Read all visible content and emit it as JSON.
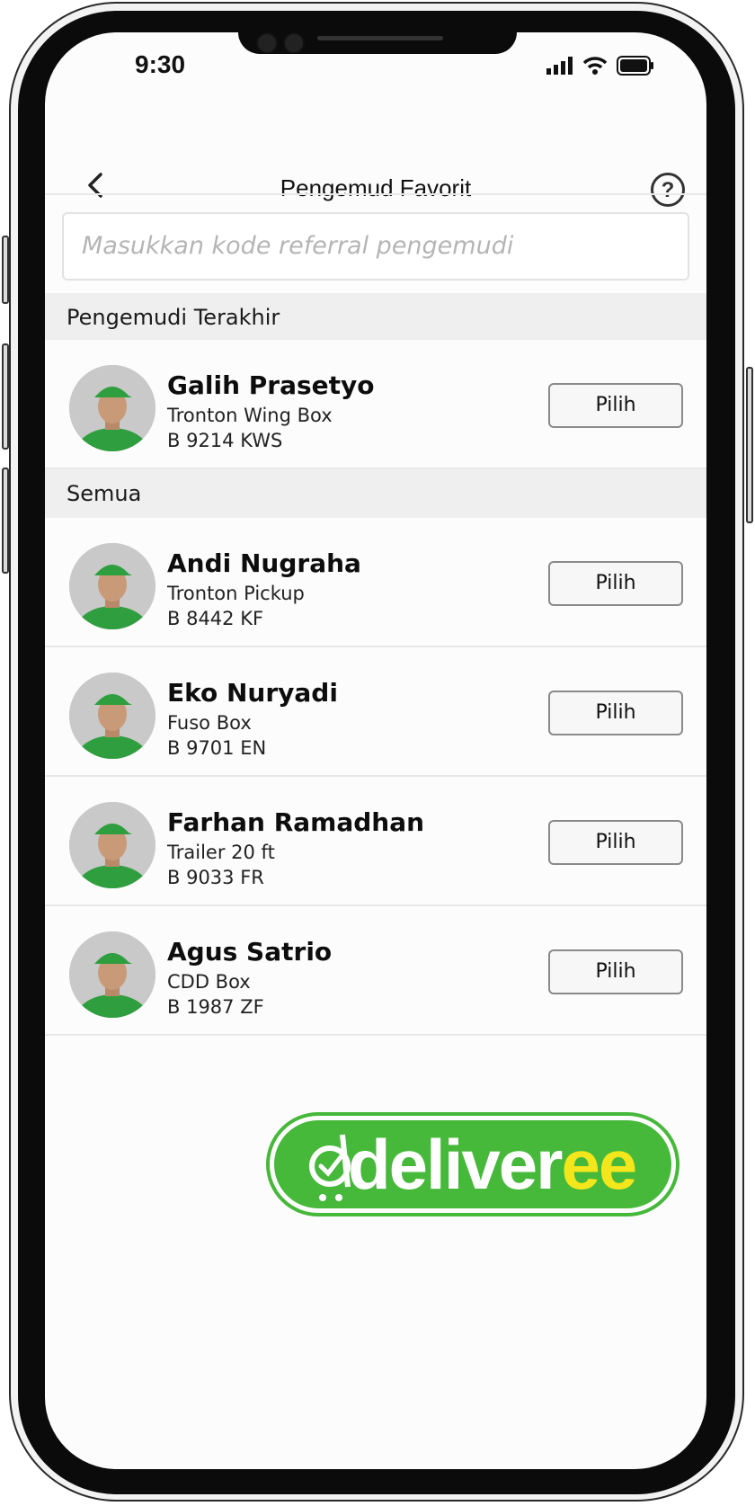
{
  "status_bar": {
    "time": "9:30"
  },
  "header": {
    "title": "Pengemud Favorit",
    "help_label": "?"
  },
  "search": {
    "placeholder": "Masukkan kode referral pengemudi"
  },
  "sections": {
    "recent": "Pengemudi Terakhir",
    "all": "Semua"
  },
  "recent_drivers": [
    {
      "name": "Galih Prasetyo",
      "vehicle": "Tronton Wing Box",
      "plate": "B 9214 KWS",
      "button": "Pilih"
    }
  ],
  "all_drivers": [
    {
      "name": "Andi Nugraha",
      "vehicle": "Tronton Pickup",
      "plate": "B 8442 KF",
      "button": "Pilih"
    },
    {
      "name": "Eko Nuryadi",
      "vehicle": "Fuso Box",
      "plate": "B 9701 EN",
      "button": "Pilih"
    },
    {
      "name": "Farhan Ramadhan",
      "vehicle": "Trailer 20 ft",
      "plate": "B 9033 FR",
      "button": "Pilih"
    },
    {
      "name": "Agus Satrio",
      "vehicle": "CDD Box",
      "plate": "B 1987 ZF",
      "button": "Pilih"
    }
  ],
  "brand": {
    "logo_text_white": "deliver",
    "logo_text_yellow": "ee",
    "green": "#46b83a",
    "yellow": "#f4e61c"
  },
  "icons": [
    "back-arrow-icon",
    "help-icon",
    "signal-icon",
    "wifi-icon",
    "battery-icon"
  ]
}
